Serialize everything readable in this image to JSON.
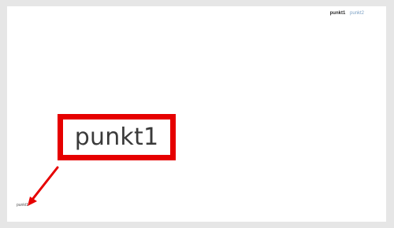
{
  "top_tabs": {
    "active_label": "punkt1",
    "inactive_label": "punkt2"
  },
  "callout": {
    "label": "punkt1"
  },
  "bottom_left": {
    "label": "punkt1"
  },
  "colors": {
    "callout_red": "#e60000",
    "link_blue": "#7ea1c4",
    "background": "#e6e6e6"
  }
}
